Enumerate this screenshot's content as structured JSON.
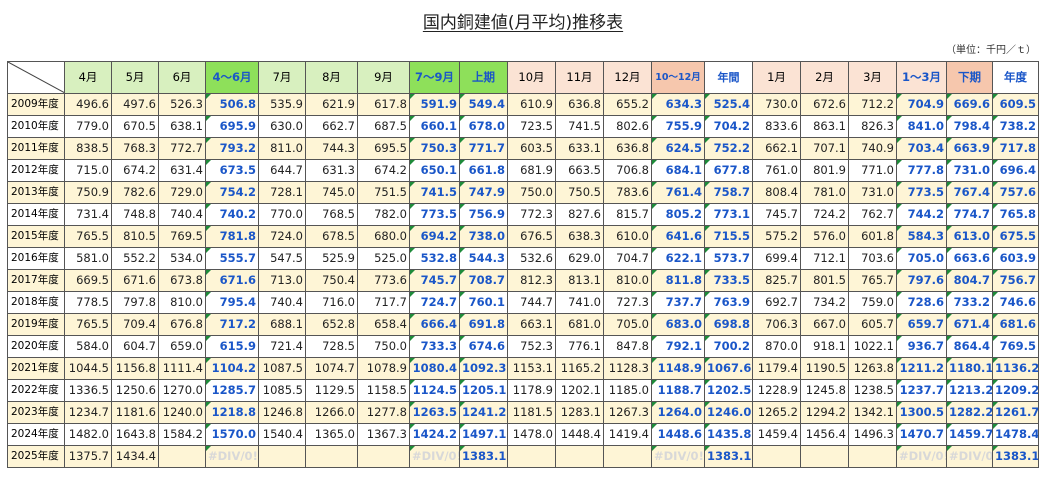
{
  "title": "国内銅建値(月平均)推移表",
  "unit": "（単位：千円／ｔ）",
  "headers": [
    "4月",
    "5月",
    "6月",
    "4～6月",
    "7月",
    "8月",
    "9月",
    "7～9月",
    "上期",
    "10月",
    "11月",
    "12月",
    "10～12月",
    "年間",
    "1月",
    "2月",
    "3月",
    "1～3月",
    "下期",
    "年度"
  ],
  "rows": [
    {
      "year": "2009年度",
      "vals": [
        "496.6",
        "497.6",
        "526.3",
        "506.8",
        "535.9",
        "621.9",
        "617.8",
        "591.9",
        "549.4",
        "610.9",
        "636.8",
        "655.2",
        "634.3",
        "525.4",
        "730.0",
        "672.6",
        "712.2",
        "704.9",
        "669.6",
        "609.5"
      ]
    },
    {
      "year": "2010年度",
      "vals": [
        "779.0",
        "670.5",
        "638.1",
        "695.9",
        "630.0",
        "662.7",
        "687.5",
        "660.1",
        "678.0",
        "723.5",
        "741.5",
        "802.6",
        "755.9",
        "704.2",
        "833.6",
        "863.1",
        "826.3",
        "841.0",
        "798.4",
        "738.2"
      ]
    },
    {
      "year": "2011年度",
      "vals": [
        "838.5",
        "768.3",
        "772.7",
        "793.2",
        "811.0",
        "744.3",
        "695.5",
        "750.3",
        "771.7",
        "603.5",
        "633.1",
        "636.8",
        "624.5",
        "752.2",
        "662.1",
        "707.1",
        "740.9",
        "703.4",
        "663.9",
        "717.8"
      ]
    },
    {
      "year": "2012年度",
      "vals": [
        "715.0",
        "674.2",
        "631.4",
        "673.5",
        "644.7",
        "631.3",
        "674.2",
        "650.1",
        "661.8",
        "681.9",
        "663.5",
        "706.8",
        "684.1",
        "677.8",
        "761.0",
        "801.9",
        "771.0",
        "777.8",
        "731.0",
        "696.4"
      ]
    },
    {
      "year": "2013年度",
      "vals": [
        "750.9",
        "782.6",
        "729.0",
        "754.2",
        "728.1",
        "745.0",
        "751.5",
        "741.5",
        "747.9",
        "750.0",
        "750.5",
        "783.6",
        "761.4",
        "758.7",
        "808.4",
        "781.0",
        "731.0",
        "773.5",
        "767.4",
        "757.6"
      ]
    },
    {
      "year": "2014年度",
      "vals": [
        "731.4",
        "748.8",
        "740.4",
        "740.2",
        "770.0",
        "768.5",
        "782.0",
        "773.5",
        "756.9",
        "772.3",
        "827.6",
        "815.7",
        "805.2",
        "773.1",
        "745.7",
        "724.2",
        "762.7",
        "744.2",
        "774.7",
        "765.8"
      ]
    },
    {
      "year": "2015年度",
      "vals": [
        "765.5",
        "810.5",
        "769.5",
        "781.8",
        "724.0",
        "678.5",
        "680.0",
        "694.2",
        "738.0",
        "676.5",
        "638.3",
        "610.0",
        "641.6",
        "715.5",
        "575.2",
        "576.0",
        "601.8",
        "584.3",
        "613.0",
        "675.5"
      ]
    },
    {
      "year": "2016年度",
      "vals": [
        "581.0",
        "552.2",
        "534.0",
        "555.7",
        "547.5",
        "525.9",
        "525.0",
        "532.8",
        "544.3",
        "532.6",
        "629.0",
        "704.7",
        "622.1",
        "573.7",
        "699.4",
        "712.1",
        "703.6",
        "705.0",
        "663.6",
        "603.9"
      ]
    },
    {
      "year": "2017年度",
      "vals": [
        "669.5",
        "671.6",
        "673.8",
        "671.6",
        "713.0",
        "750.4",
        "773.6",
        "745.7",
        "708.7",
        "812.3",
        "813.1",
        "810.0",
        "811.8",
        "733.5",
        "825.7",
        "801.5",
        "765.7",
        "797.6",
        "804.7",
        "756.7"
      ]
    },
    {
      "year": "2018年度",
      "vals": [
        "778.5",
        "797.8",
        "810.0",
        "795.4",
        "740.4",
        "716.0",
        "717.7",
        "724.7",
        "760.1",
        "744.7",
        "741.0",
        "727.3",
        "737.7",
        "763.9",
        "692.7",
        "734.2",
        "759.0",
        "728.6",
        "733.2",
        "746.6"
      ]
    },
    {
      "year": "2019年度",
      "vals": [
        "765.5",
        "709.4",
        "676.8",
        "717.2",
        "688.1",
        "652.8",
        "658.4",
        "666.4",
        "691.8",
        "663.1",
        "681.0",
        "705.0",
        "683.0",
        "698.8",
        "706.3",
        "667.0",
        "605.7",
        "659.7",
        "671.4",
        "681.6"
      ]
    },
    {
      "year": "2020年度",
      "vals": [
        "584.0",
        "604.7",
        "659.0",
        "615.9",
        "721.4",
        "728.5",
        "750.0",
        "733.3",
        "674.6",
        "752.3",
        "776.1",
        "847.8",
        "792.1",
        "700.2",
        "870.0",
        "918.1",
        "1022.1",
        "936.7",
        "864.4",
        "769.5"
      ]
    },
    {
      "year": "2021年度",
      "vals": [
        "1044.5",
        "1156.8",
        "1111.4",
        "1104.2",
        "1087.5",
        "1074.7",
        "1078.9",
        "1080.4",
        "1092.3",
        "1153.1",
        "1165.2",
        "1128.3",
        "1148.9",
        "1067.6",
        "1179.4",
        "1190.5",
        "1263.8",
        "1211.2",
        "1180.1",
        "1136.2"
      ]
    },
    {
      "year": "2022年度",
      "vals": [
        "1336.5",
        "1250.6",
        "1270.0",
        "1285.7",
        "1085.5",
        "1129.5",
        "1158.5",
        "1124.5",
        "1205.1",
        "1178.9",
        "1202.1",
        "1185.0",
        "1188.7",
        "1202.5",
        "1228.9",
        "1245.8",
        "1238.5",
        "1237.7",
        "1213.2",
        "1209.2"
      ]
    },
    {
      "year": "2023年度",
      "vals": [
        "1234.7",
        "1181.6",
        "1240.0",
        "1218.8",
        "1246.8",
        "1266.0",
        "1277.8",
        "1263.5",
        "1241.2",
        "1181.5",
        "1283.1",
        "1267.3",
        "1264.0",
        "1246.0",
        "1265.2",
        "1294.2",
        "1342.1",
        "1300.5",
        "1282.2",
        "1261.7"
      ]
    },
    {
      "year": "2024年度",
      "vals": [
        "1482.0",
        "1643.8",
        "1584.2",
        "1570.0",
        "1540.4",
        "1365.0",
        "1367.3",
        "1424.2",
        "1497.1",
        "1478.0",
        "1448.4",
        "1419.4",
        "1448.6",
        "1435.8",
        "1459.4",
        "1456.4",
        "1496.3",
        "1470.7",
        "1459.7",
        "1478.4"
      ]
    },
    {
      "year": "2025年度",
      "vals": [
        "1375.7",
        "1434.4",
        "",
        "#DIV/0!",
        "",
        "",
        "",
        "#DIV/0!",
        "1383.1",
        "",
        "",
        "",
        "#DIV/0!",
        "1383.1",
        "",
        "",
        "",
        "#DIV/0!",
        "#DIV/0!",
        "1383.1"
      ]
    }
  ],
  "colors": {
    "month_header_green": "#d8f0bf",
    "quarter_header_green": "#8ee05a",
    "month_header_peach": "#fbe3d4",
    "quarter_header_peach": "#f6c7ad",
    "summary_text_blue": "#1a56c8",
    "row_alt_yellow": "#fef5d6"
  }
}
